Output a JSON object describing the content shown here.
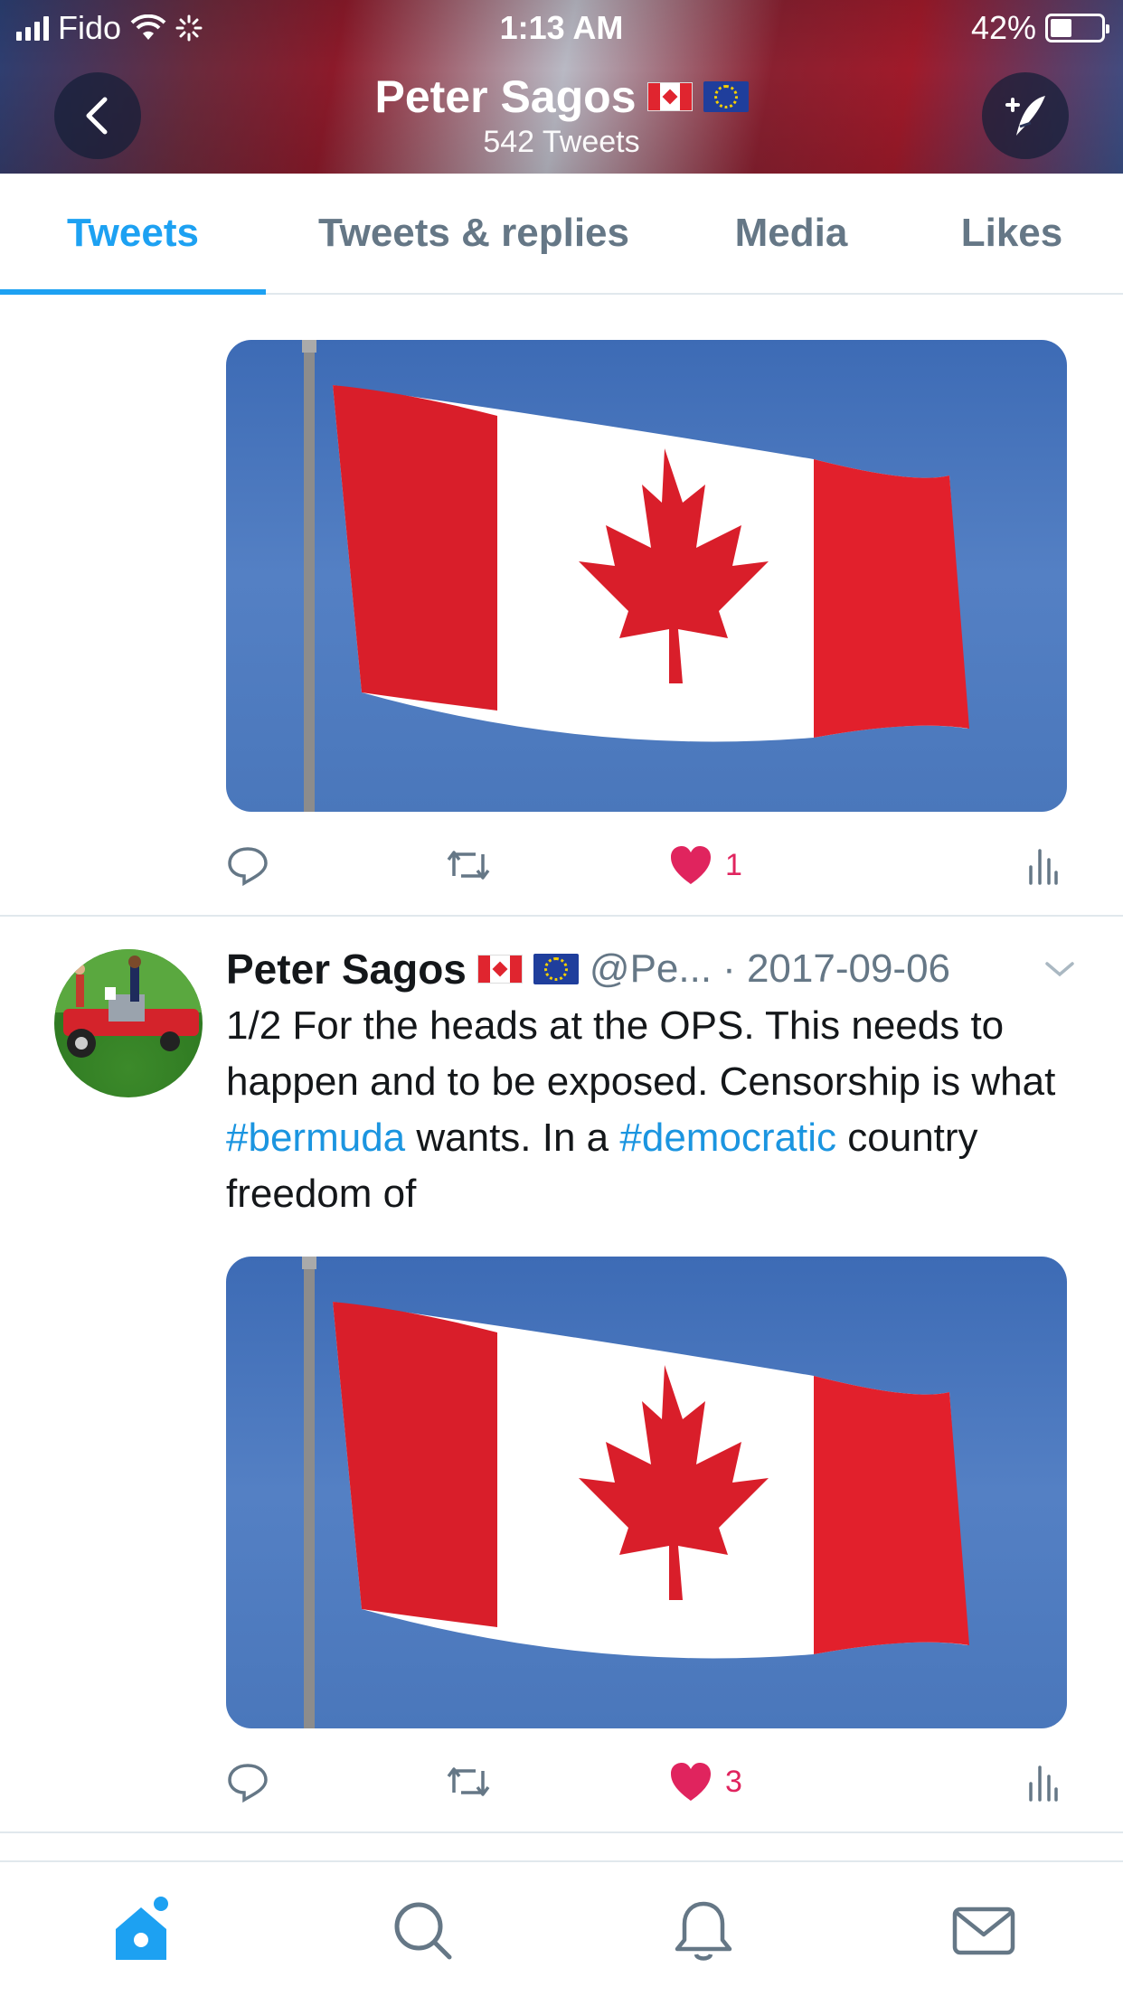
{
  "status_bar": {
    "carrier": "Fido",
    "time": "1:13 AM",
    "battery": "42%",
    "battery_level": 0.42
  },
  "header": {
    "name": "Peter Sagos",
    "tweet_count": "542 Tweets",
    "flags": [
      "canada-flag-icon",
      "eu-flag-icon"
    ]
  },
  "tabs": [
    {
      "label": "Tweets",
      "active": true
    },
    {
      "label": "Tweets & replies",
      "active": false
    },
    {
      "label": "Media",
      "active": false
    },
    {
      "label": "Likes",
      "active": false
    }
  ],
  "tweets": [
    {
      "like_count": "1"
    },
    {
      "name": "Peter Sagos",
      "handle": "@Pe...",
      "date": "· 2017-09-06",
      "text_parts": [
        "1/2 For the heads at the OPS. This needs to happen and to be exposed. Censorship is what ",
        "#bermuda",
        " wants. In a ",
        "#democratic",
        " country freedom of"
      ],
      "like_count": "3"
    }
  ],
  "colors": {
    "accent": "#1da1f2",
    "like": "#e0245e",
    "secondary_text": "#657786",
    "flag_red": "#e0252f"
  },
  "bottom_nav": [
    "home-icon",
    "search-icon",
    "notifications-icon",
    "messages-icon"
  ]
}
